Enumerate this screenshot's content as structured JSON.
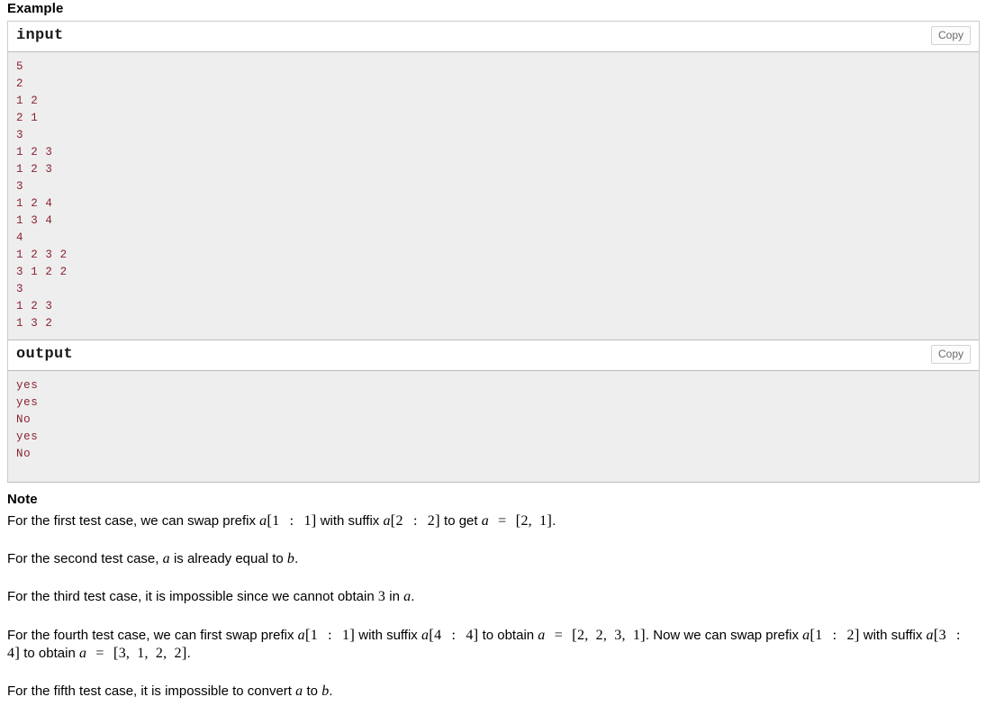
{
  "headings": {
    "example": "Example",
    "note": "Note"
  },
  "sample_tests": {
    "copy_label": "Copy",
    "blocks": [
      {
        "title": "input",
        "lines": [
          "5",
          "2",
          "1 2",
          "2 1",
          "3",
          "1 2 3",
          "1 2 3",
          "3",
          "1 2 4",
          "1 3 4",
          "4",
          "1 2 3 2",
          "3 1 2 2",
          "3",
          "1 2 3",
          "1 3 2"
        ]
      },
      {
        "title": "output",
        "lines": [
          "yes",
          "yes",
          "No",
          "yes",
          "No"
        ]
      }
    ]
  },
  "note": {
    "paragraphs": [
      {
        "id": "first-test-case",
        "parts": [
          {
            "type": "text",
            "value": "For the first test case, we can swap prefix "
          },
          {
            "type": "math",
            "value": "a[1 : 1]"
          },
          {
            "type": "text",
            "value": " with suffix "
          },
          {
            "type": "math",
            "value": "a[2 : 2]"
          },
          {
            "type": "text",
            "value": " to get "
          },
          {
            "type": "math",
            "value": "a = [2, 1]"
          },
          {
            "type": "text",
            "value": "."
          }
        ]
      },
      {
        "id": "second-test-case",
        "parts": [
          {
            "type": "text",
            "value": "For the second test case, "
          },
          {
            "type": "math",
            "value": "a"
          },
          {
            "type": "text",
            "value": " is already equal to "
          },
          {
            "type": "math",
            "value": "b"
          },
          {
            "type": "text",
            "value": "."
          }
        ]
      },
      {
        "id": "third-test-case",
        "parts": [
          {
            "type": "text",
            "value": "For the third test case, it is impossible since we cannot obtain "
          },
          {
            "type": "math",
            "value": "3"
          },
          {
            "type": "text",
            "value": " in "
          },
          {
            "type": "math",
            "value": "a"
          },
          {
            "type": "text",
            "value": "."
          }
        ]
      },
      {
        "id": "fourth-test-case",
        "parts": [
          {
            "type": "text",
            "value": "For the fourth test case, we can first swap prefix "
          },
          {
            "type": "math",
            "value": "a[1 : 1]"
          },
          {
            "type": "text",
            "value": " with suffix "
          },
          {
            "type": "math",
            "value": "a[4 : 4]"
          },
          {
            "type": "text",
            "value": " to obtain "
          },
          {
            "type": "math",
            "value": "a = [2, 2, 3, 1]"
          },
          {
            "type": "text",
            "value": ". Now we can swap prefix "
          },
          {
            "type": "math",
            "value": "a[1 : 2]"
          },
          {
            "type": "text",
            "value": " with suffix "
          },
          {
            "type": "math",
            "value": "a[3 : 4]"
          },
          {
            "type": "text",
            "value": " to obtain "
          },
          {
            "type": "math",
            "value": "a = [3, 1, 2, 2]"
          },
          {
            "type": "text",
            "value": "."
          }
        ]
      },
      {
        "id": "fifth-test-case",
        "parts": [
          {
            "type": "text",
            "value": "For the fifth test case, it is impossible to convert "
          },
          {
            "type": "math",
            "value": "a"
          },
          {
            "type": "text",
            "value": " to "
          },
          {
            "type": "math",
            "value": "b"
          },
          {
            "type": "text",
            "value": "."
          }
        ]
      }
    ]
  },
  "colors": {
    "code_text": "#8a2232",
    "code_background": "#eeeeee",
    "panel_border": "#bbbbbb",
    "copy_button_text": "#6b6b6b"
  }
}
